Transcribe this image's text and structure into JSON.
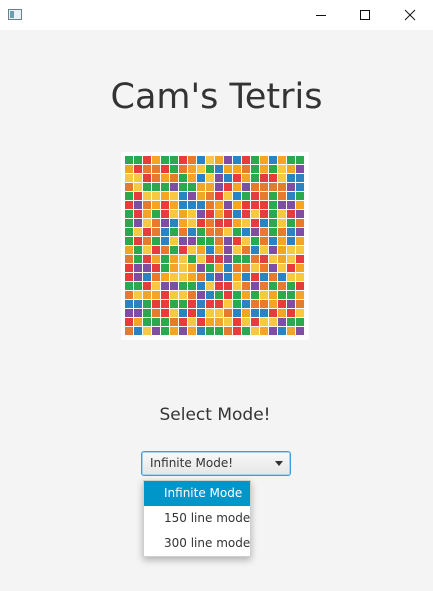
{
  "window": {
    "app_icon": "window-app-icon",
    "controls": [
      "minimize-icon",
      "maximize-icon",
      "close-icon"
    ]
  },
  "title": "Cam's Tetris",
  "logo": {
    "icon": "tetris-block-mosaic",
    "colors": [
      "#e63c3c",
      "#f5a524",
      "#f7c940",
      "#2aa94f",
      "#2a84c4",
      "#7e4ea3",
      "#e87a2e"
    ]
  },
  "mode": {
    "label": "Select Mode!",
    "selected": "Infinite Mode!",
    "options": [
      "Infinite Mode",
      "150 line mode",
      "300 line mode"
    ],
    "highlighted_index": 0
  },
  "colors": {
    "accent": "#0096c9",
    "focus_border": "#3d9ed9",
    "background": "#f4f4f4"
  }
}
